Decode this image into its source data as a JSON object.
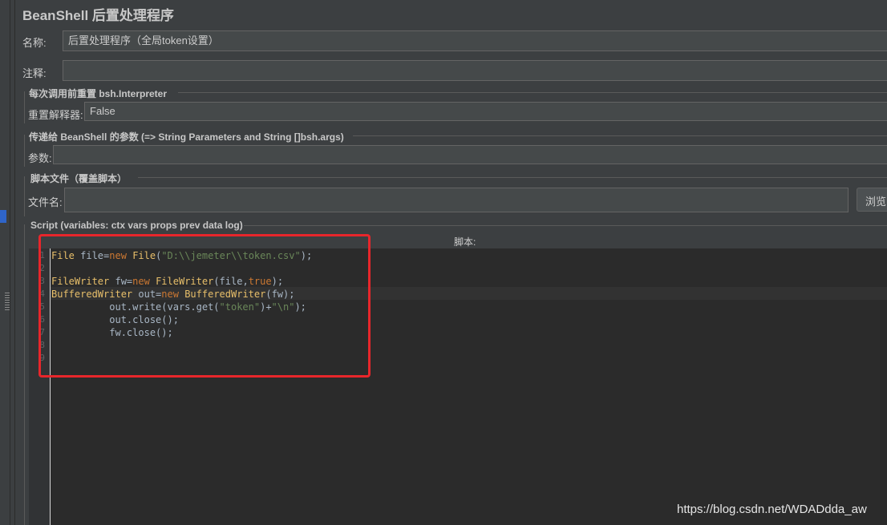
{
  "title": "BeanShell 后置处理程序",
  "form": {
    "name_label": "名称:",
    "name_value": "后置处理程序（全局token设置）",
    "comment_label": "注释:",
    "comment_value": ""
  },
  "reset_group": {
    "title": "每次调用前重置 bsh.Interpreter",
    "label": "重置解释器:",
    "value": "False"
  },
  "params_group": {
    "title": "传递给 BeanShell 的参数 (=> String Parameters and String []bsh.args)",
    "label": "参数:",
    "value": ""
  },
  "file_group": {
    "title": "脚本文件（覆盖脚本）",
    "label": "文件名:",
    "value": "",
    "browse_label": "浏览..."
  },
  "script_group": {
    "title": "Script (variables: ctx vars props prev data log)",
    "editor_label": "脚本:",
    "line_numbers": [
      "1",
      "2",
      "3",
      "4",
      "5",
      "6",
      "7",
      "8",
      "9"
    ],
    "lines": [
      "File file=new File(\"D:\\\\jemeter\\\\token.csv\");",
      "",
      "FileWriter fw=new FileWriter(file,true);",
      "BufferedWriter out=new BufferedWriter(fw);",
      "          out.write(vars.get(\"token\")+\"\\n\");",
      "          out.close();",
      "          fw.close();",
      "",
      ""
    ]
  },
  "watermark": "https://blog.csdn.net/WDADdda_aw",
  "colors": {
    "background": "#3c3f41",
    "editor_bg": "#2b2b2b",
    "keyword": "#cc7832",
    "string": "#6a8759",
    "highlight_box": "#e8262b"
  }
}
